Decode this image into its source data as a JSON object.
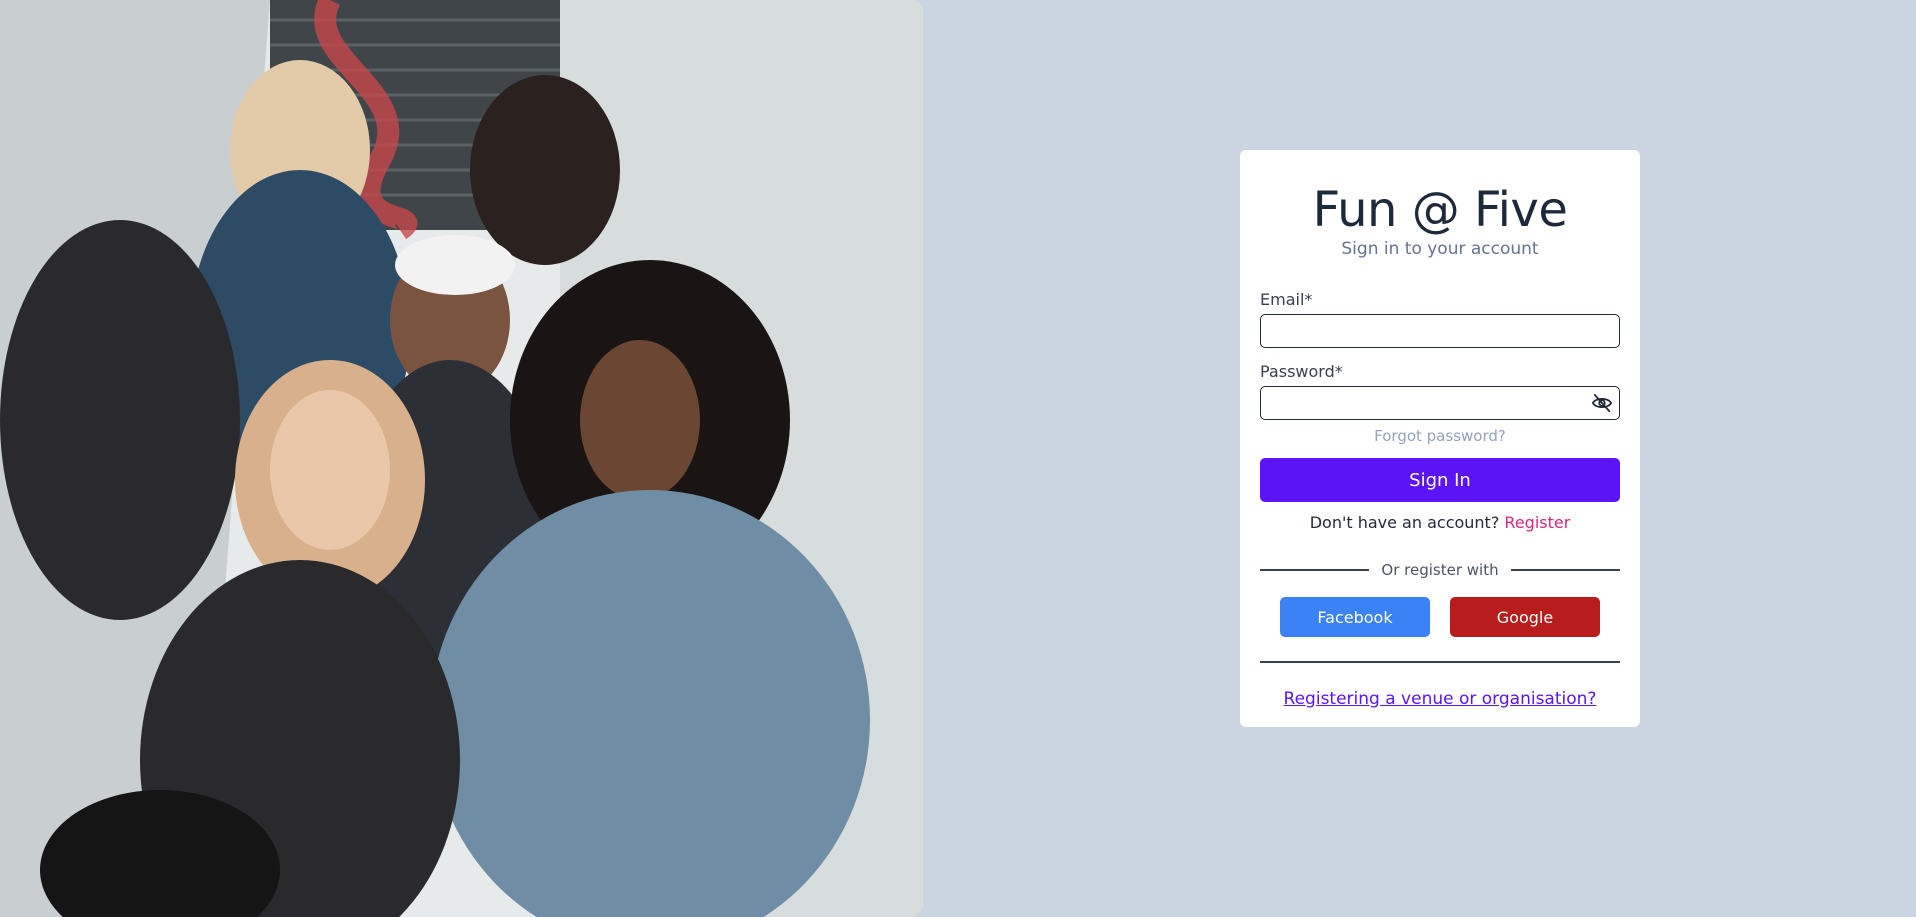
{
  "hero": {
    "image": "group-of-women-on-stairs-photo"
  },
  "login": {
    "title": "Fun @ Five",
    "subtitle": "Sign in to your account",
    "email_label": "Email*",
    "email_value": "",
    "password_label": "Password*",
    "password_value": "",
    "password_toggle_icon": "eye-off-icon",
    "forgot_label": "Forgot password?",
    "signin_label": "Sign In",
    "no_account_text": "Don't have an account?",
    "register_link": "Register",
    "divider_text": "Or register with",
    "facebook_label": "Facebook",
    "google_label": "Google",
    "venue_link": "Registering a venue or organisation?"
  },
  "colors": {
    "background": "#cbd5e1",
    "primary": "#5b14f5",
    "register_link": "#db2777",
    "facebook": "#3b82f6",
    "google": "#b91c1c"
  }
}
